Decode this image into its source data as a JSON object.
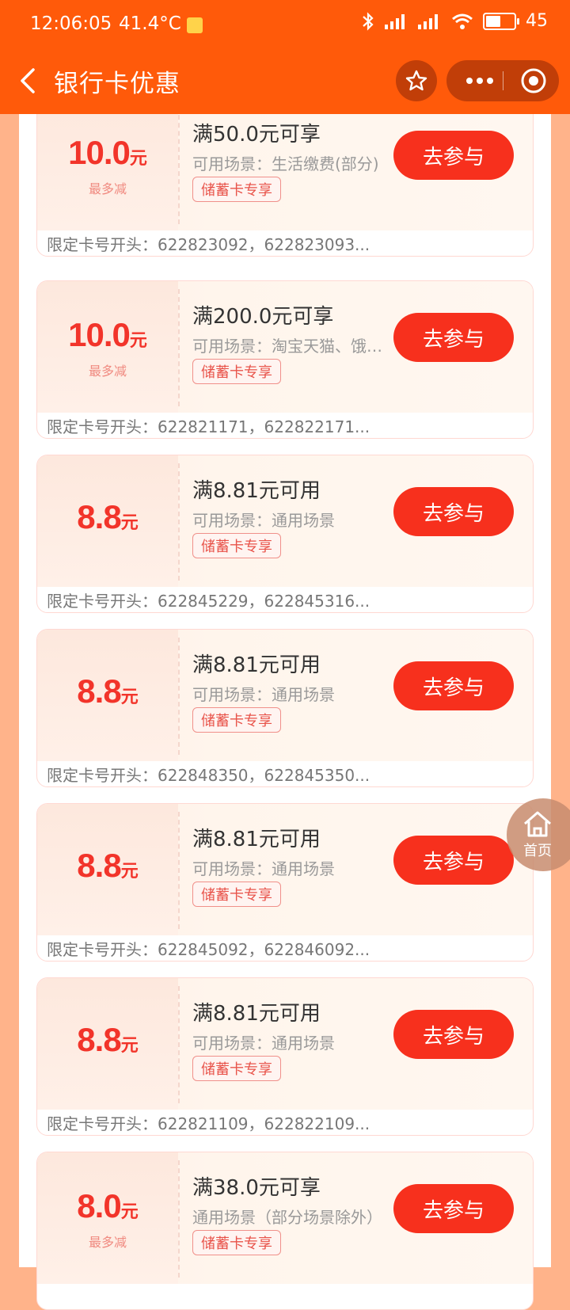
{
  "status": {
    "time": "12:06:05",
    "temp": "41.4°C",
    "battery": "45"
  },
  "nav": {
    "title": "银行卡优惠"
  },
  "home_button": {
    "label": "首页"
  },
  "coupons": [
    {
      "amount": "10.0",
      "unit": "元",
      "max_label": "最多减",
      "condition": "满50.0元可享",
      "scene": "可用场景：生活缴费(部分)",
      "tag": "储蓄卡专享",
      "button": "去参与",
      "cards": "限定卡号开头：622823092，622823093..."
    },
    {
      "amount": "10.0",
      "unit": "元",
      "max_label": "最多减",
      "condition": "满200.0元可享",
      "scene": "可用场景：淘宝天猫、饿…",
      "tag": "储蓄卡专享",
      "button": "去参与",
      "cards": "限定卡号开头：622821171，622822171..."
    },
    {
      "amount": "8.8",
      "unit": "元",
      "max_label": "",
      "condition": "满8.81元可用",
      "scene": "可用场景：通用场景",
      "tag": "储蓄卡专享",
      "button": "去参与",
      "cards": "限定卡号开头：622845229，622845316..."
    },
    {
      "amount": "8.8",
      "unit": "元",
      "max_label": "",
      "condition": "满8.81元可用",
      "scene": "可用场景：通用场景",
      "tag": "储蓄卡专享",
      "button": "去参与",
      "cards": "限定卡号开头：622848350，622845350..."
    },
    {
      "amount": "8.8",
      "unit": "元",
      "max_label": "",
      "condition": "满8.81元可用",
      "scene": "可用场景：通用场景",
      "tag": "储蓄卡专享",
      "button": "去参与",
      "cards": "限定卡号开头：622845092，622846092..."
    },
    {
      "amount": "8.8",
      "unit": "元",
      "max_label": "",
      "condition": "满8.81元可用",
      "scene": "可用场景：通用场景",
      "tag": "储蓄卡专享",
      "button": "去参与",
      "cards": "限定卡号开头：622821109，622822109..."
    },
    {
      "amount": "8.0",
      "unit": "元",
      "max_label": "最多减",
      "condition": "满38.0元可享",
      "scene": "通用场景（部分场景除外）",
      "tag": "储蓄卡专享",
      "button": "去参与",
      "cards": ""
    }
  ],
  "colors": {
    "header": "#ff5a0a",
    "button": "#f7301d",
    "amount": "#f2342a"
  }
}
